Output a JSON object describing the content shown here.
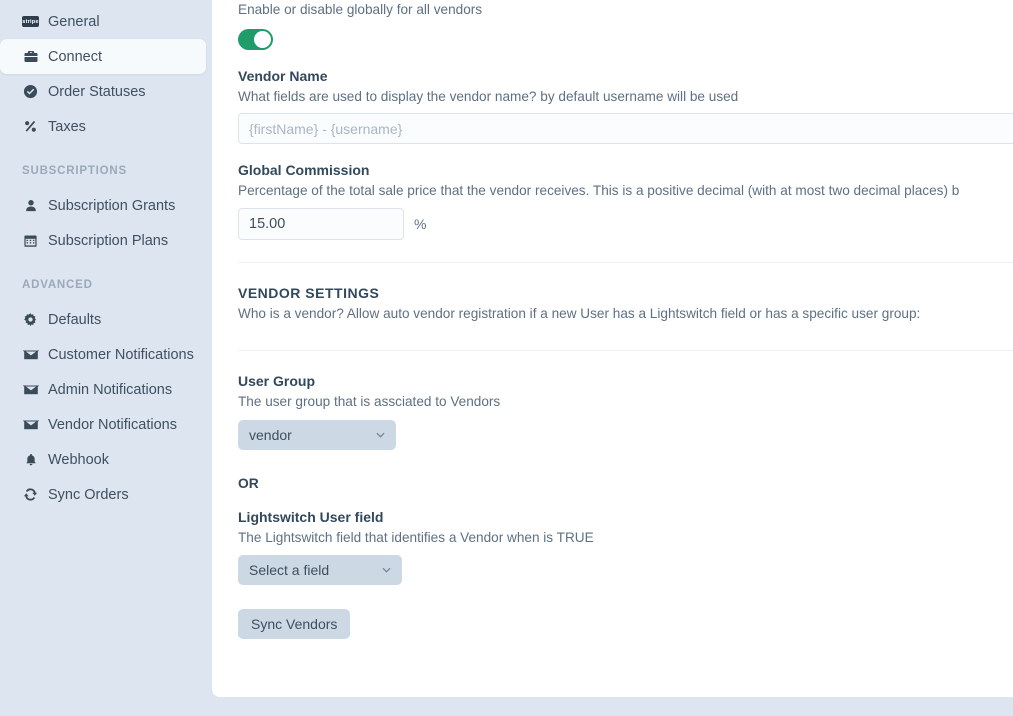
{
  "sidebar": {
    "items": [
      {
        "label": "General",
        "icon": "stripe-logo-icon",
        "active": false
      },
      {
        "label": "Connect",
        "icon": "briefcase-icon",
        "active": true
      },
      {
        "label": "Order Statuses",
        "icon": "check-circle-icon",
        "active": false
      },
      {
        "label": "Taxes",
        "icon": "percent-icon",
        "active": false
      }
    ],
    "sections": [
      {
        "title": "SUBSCRIPTIONS",
        "items": [
          {
            "label": "Subscription Grants",
            "icon": "user-icon"
          },
          {
            "label": "Subscription Plans",
            "icon": "calendar-icon"
          }
        ]
      },
      {
        "title": "ADVANCED",
        "items": [
          {
            "label": "Defaults",
            "icon": "gear-icon"
          },
          {
            "label": "Customer Notifications",
            "icon": "envelope-icon"
          },
          {
            "label": "Admin Notifications",
            "icon": "envelope-icon"
          },
          {
            "label": "Vendor Notifications",
            "icon": "envelope-icon"
          },
          {
            "label": "Webhook",
            "icon": "bell-icon"
          },
          {
            "label": "Sync Orders",
            "icon": "refresh-icon"
          }
        ]
      }
    ]
  },
  "main": {
    "enable_globally": {
      "description": "Enable or disable globally for all vendors",
      "toggle_on": true
    },
    "vendor_name": {
      "label": "Vendor Name",
      "description": "What fields are used to display the vendor name? by default username will be used",
      "placeholder": "{firstName} - {username}",
      "value": ""
    },
    "global_commission": {
      "label": "Global Commission",
      "description": "Percentage of the total sale price that the vendor receives. This is a positive decimal (with at most two decimal places) b",
      "value": "15.00",
      "unit": "%"
    },
    "vendor_settings": {
      "title": "VENDOR SETTINGS",
      "description": "Who is a vendor? Allow auto vendor registration if a new User has a Lightswitch field or has a specific user group:"
    },
    "user_group": {
      "label": "User Group",
      "description": "The user group that is assciated to Vendors",
      "selected": "vendor",
      "options": [
        "vendor"
      ]
    },
    "or_label": "OR",
    "lightswitch": {
      "label": "Lightswitch User field",
      "description": "The Lightswitch field that identifies a Vendor when is TRUE",
      "selected": "Select a field",
      "options": [
        "Select a field"
      ]
    },
    "sync_button": "Sync Vendors"
  },
  "colors": {
    "toggle_on": "#1f9c6a",
    "sidebar_bg": "#dde5f0",
    "card_bg": "#ffffff",
    "control_bg": "#ccd8e4"
  }
}
